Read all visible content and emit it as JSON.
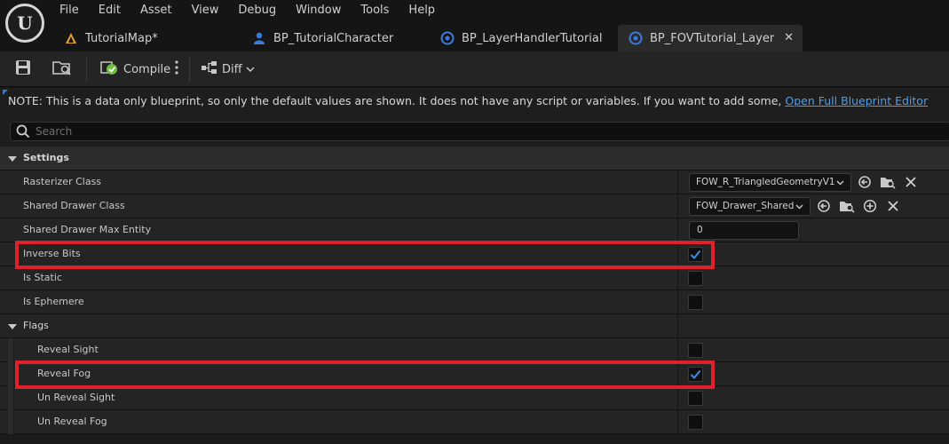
{
  "menu": [
    "File",
    "Edit",
    "Asset",
    "View",
    "Debug",
    "Window",
    "Tools",
    "Help"
  ],
  "logo_text": "U",
  "tabs": [
    {
      "label": "TutorialMap*",
      "icon": "map-icon"
    },
    {
      "label": "BP_TutorialCharacter",
      "icon": "character-icon"
    },
    {
      "label": "BP_LayerHandlerTutorial",
      "icon": "blueprint-icon"
    },
    {
      "label": "BP_FOVTutorial_Layer",
      "icon": "blueprint-icon",
      "active": true
    }
  ],
  "toolbar": {
    "compile_label": "Compile",
    "diff_label": "Diff"
  },
  "note": {
    "text": "NOTE: This is a data only blueprint, so only the default values are shown.  It does not have any script or variables.  If you want to add some, ",
    "link": "Open Full Blueprint Editor"
  },
  "search": {
    "placeholder": "Search",
    "value": ""
  },
  "settings": {
    "category": "Settings",
    "rasterizer_class": {
      "label": "Rasterizer Class",
      "value": "FOW_R_TriangledGeometryV1"
    },
    "shared_drawer_class": {
      "label": "Shared Drawer Class",
      "value": "FOW_Drawer_Shared"
    },
    "shared_drawer_max_entity": {
      "label": "Shared Drawer Max Entity",
      "value": "0"
    },
    "inverse_bits": {
      "label": "Inverse Bits",
      "checked": true
    },
    "is_static": {
      "label": "Is Static",
      "checked": false
    },
    "is_ephemere": {
      "label": "Is Ephemere",
      "checked": false
    }
  },
  "flags": {
    "category": "Flags",
    "reveal_sight": {
      "label": "Reveal Sight",
      "checked": false
    },
    "reveal_fog": {
      "label": "Reveal Fog",
      "checked": true
    },
    "un_reveal_sight": {
      "label": "Un Reveal Sight",
      "checked": false
    },
    "un_reveal_fog": {
      "label": "Un Reveal Fog",
      "checked": false
    }
  },
  "colors": {
    "highlight": "#e0202a",
    "link": "#4a9ff0",
    "check": "#3a8ee6",
    "compile_ok": "#6fbf3f"
  }
}
